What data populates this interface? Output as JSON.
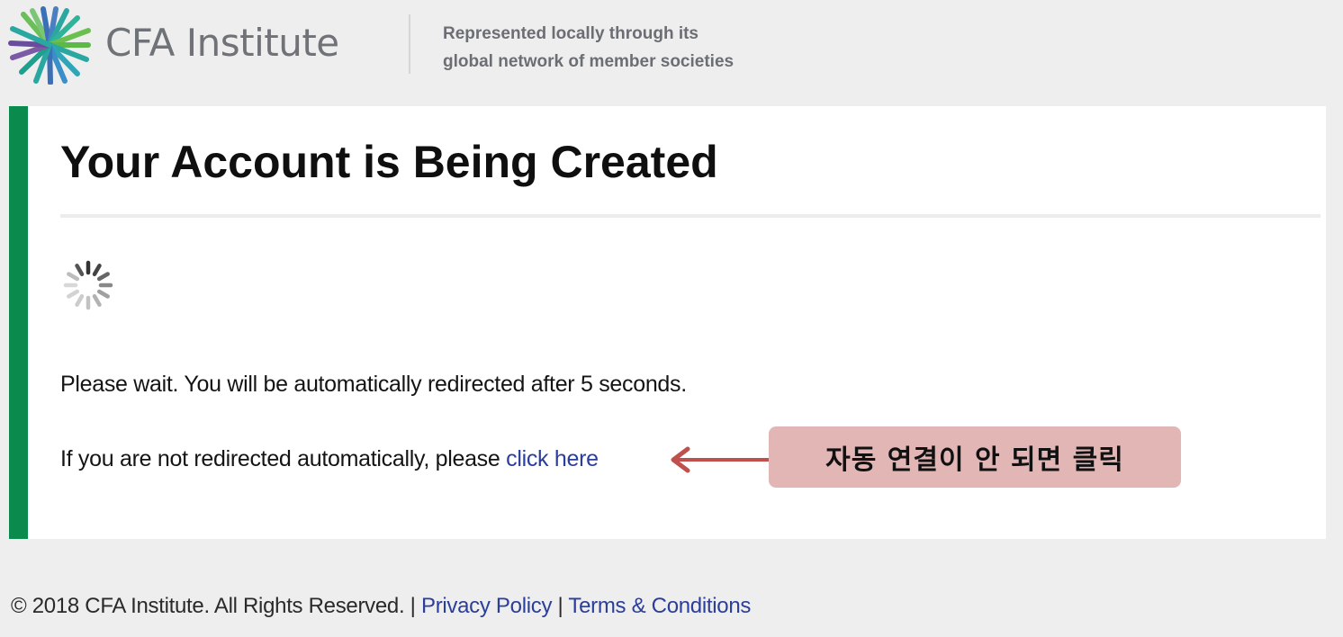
{
  "header": {
    "logo_icon": "cfa-starburst-logo",
    "logo_text": "CFA Institute",
    "tagline_line1": "Represented locally through its",
    "tagline_line2": "global network of member societies"
  },
  "card": {
    "accent_color": "#0b8a4e",
    "title": "Your Account is Being Created",
    "spinner_icon": "loading-spinner-icon",
    "wait_text": "Please wait. You will be automatically redirected after 5 seconds.",
    "redirect_prefix": "If you are not redirected automatically, please ",
    "redirect_link": "click here"
  },
  "annotation": {
    "arrow_icon": "arrow-left-icon",
    "text": "자동 연결이 안 되면 클릭",
    "box_color": "#e3b6b6",
    "arrow_color": "#c0504d"
  },
  "footer": {
    "copyright": "© 2018 CFA Institute. All Rights Reserved.",
    "separator": " | ",
    "privacy_link": "Privacy Policy",
    "terms_link": "Terms & Conditions",
    "link_color": "#2b3e99"
  }
}
